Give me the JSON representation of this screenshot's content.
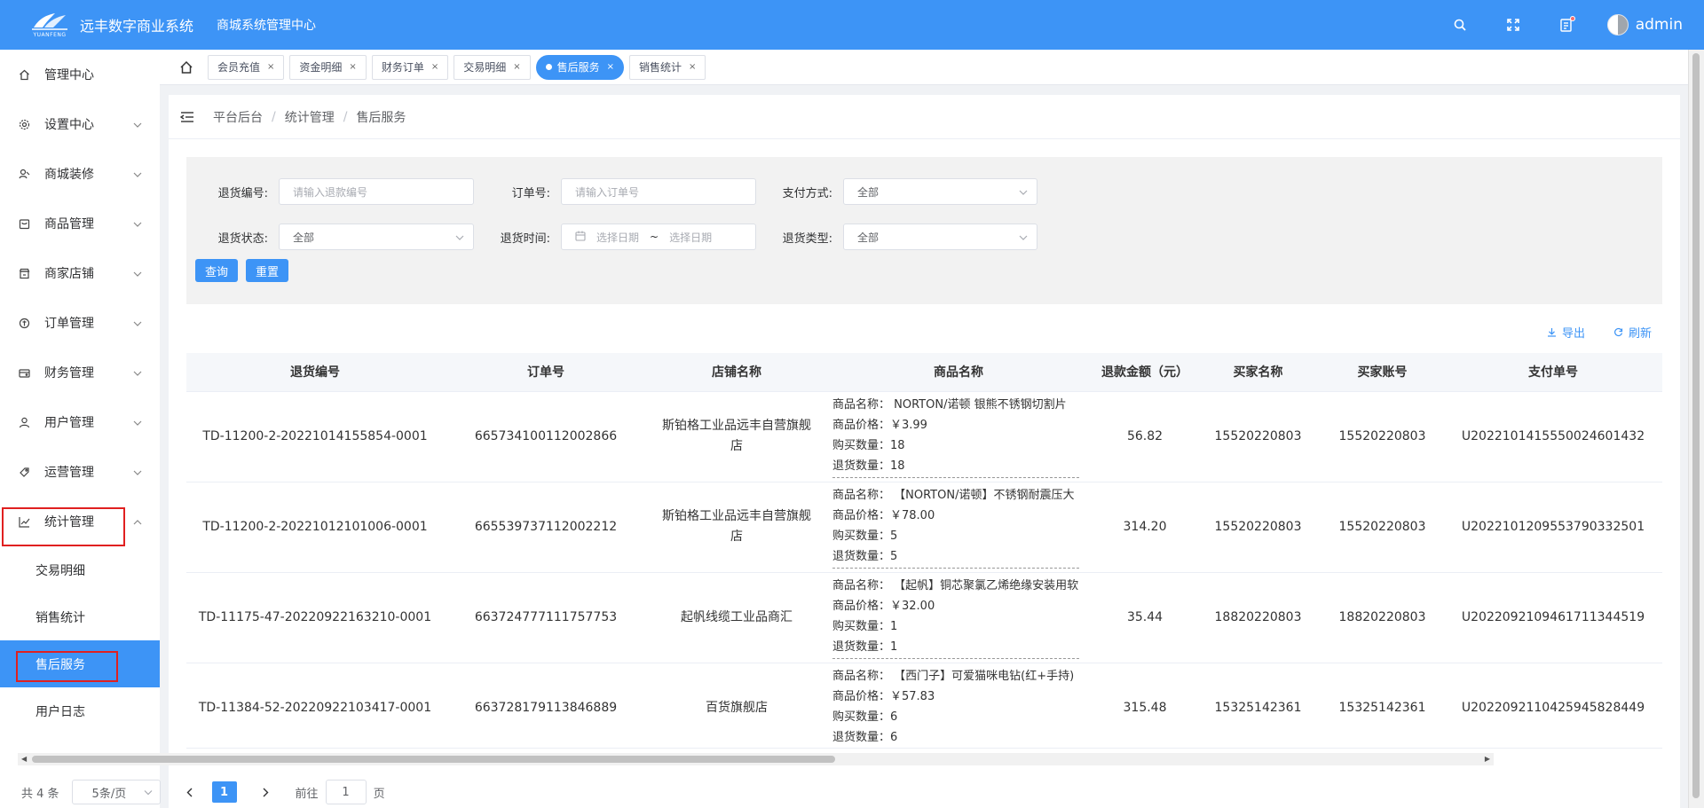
{
  "header": {
    "logo_text": "YUANFENG",
    "app_title": "远丰数字商业系统",
    "sub_title": "商城系统管理中心",
    "username": "admin"
  },
  "sidebar": {
    "items": [
      {
        "label": "管理中心",
        "icon": "home-icon"
      },
      {
        "label": "设置中心",
        "icon": "gear-icon"
      },
      {
        "label": "商城装修",
        "icon": "paint-icon"
      },
      {
        "label": "商品管理",
        "icon": "goods-icon"
      },
      {
        "label": "商家店铺",
        "icon": "store-icon"
      },
      {
        "label": "订单管理",
        "icon": "order-icon"
      },
      {
        "label": "财务管理",
        "icon": "finance-icon"
      },
      {
        "label": "用户管理",
        "icon": "user-icon"
      },
      {
        "label": "运营管理",
        "icon": "operation-icon"
      },
      {
        "label": "统计管理",
        "icon": "chart-icon"
      }
    ],
    "sub_items": [
      "交易明细",
      "销售统计",
      "售后服务",
      "用户日志"
    ],
    "active_sub": "售后服务"
  },
  "tabs": [
    {
      "label": "会员充值"
    },
    {
      "label": "资金明细"
    },
    {
      "label": "财务订单"
    },
    {
      "label": "交易明细"
    },
    {
      "label": "售后服务",
      "active": true
    },
    {
      "label": "销售统计"
    }
  ],
  "tab_close": "×",
  "breadcrumb": {
    "items": [
      "平台后台",
      "统计管理",
      "售后服务"
    ],
    "separator": "/"
  },
  "filter": {
    "return_no_label": "退货编号:",
    "return_no_placeholder": "请输入退款编号",
    "order_no_label": "订单号:",
    "order_no_placeholder": "请输入订单号",
    "pay_method_label": "支付方式:",
    "pay_method_value": "全部",
    "return_status_label": "退货状态:",
    "return_status_value": "全部",
    "return_time_label": "退货时间:",
    "date_start_placeholder": "选择日期",
    "date_sep": "~",
    "date_end_placeholder": "选择日期",
    "return_type_label": "退货类型:",
    "return_type_value": "全部",
    "query_button": "查询",
    "reset_button": "重置"
  },
  "tools": {
    "export_label": "导出",
    "refresh_label": "刷新"
  },
  "table": {
    "columns": [
      "退货编号",
      "订单号",
      "店铺名称",
      "商品名称",
      "退款金额（元）",
      "买家名称",
      "买家账号",
      "支付单号"
    ],
    "rows": [
      {
        "return_no": "TD-11200-2-20221014155854-0001",
        "order_no": "665734100112002866",
        "shop": "斯铂格工业品远丰自营旗舰店",
        "goods_name": "商品名称：  NORTON/诺顿 银熊不锈钢切割片",
        "goods_price": "商品价格：￥3.99",
        "buy_qty": "购买数量：18",
        "return_qty": "退货数量：18",
        "amount": "56.82",
        "buyer_name": "15520220803",
        "buyer_account": "15520220803",
        "pay_no": "U2022101415550024601432"
      },
      {
        "return_no": "TD-11200-2-20221012101006-0001",
        "order_no": "665539737112002212",
        "shop": "斯铂格工业品远丰自营旗舰店",
        "goods_name": "商品名称：  【NORTON/诺顿】不锈钢耐震压大",
        "goods_price": "商品价格：￥78.00",
        "buy_qty": "购买数量：5",
        "return_qty": "退货数量：5",
        "amount": "314.20",
        "buyer_name": "15520220803",
        "buyer_account": "15520220803",
        "pay_no": "U2022101209553790332501"
      },
      {
        "return_no": "TD-11175-47-20220922163210-0001",
        "order_no": "663724777111757753",
        "shop": "起帆线缆工业品商汇",
        "goods_name": "商品名称：  【起帆】铜芯聚氯乙烯绝缘安装用软",
        "goods_price": "商品价格：￥32.00",
        "buy_qty": "购买数量：1",
        "return_qty": "退货数量：1",
        "amount": "35.44",
        "buyer_name": "18820220803",
        "buyer_account": "18820220803",
        "pay_no": "U2022092109461711344519"
      },
      {
        "return_no": "TD-11384-52-20220922103417-0001",
        "order_no": "663728179113846889",
        "shop": "百货旗舰店",
        "goods_name": "商品名称：  【西门子】可爱猫咪电钻(红+手持)",
        "goods_price": "商品价格：￥57.83",
        "buy_qty": "购买数量：6",
        "return_qty": "退货数量：6",
        "amount": "315.48",
        "buyer_name": "15325142361",
        "buyer_account": "15325142361",
        "pay_no": "U2022092110425945828449"
      }
    ]
  },
  "pagination": {
    "total_text": "共 4 条",
    "page_size": "5条/页",
    "current_page": "1",
    "jump_label": "前往",
    "jump_value": "1",
    "page_unit": "页"
  },
  "colors": {
    "primary": "#3d94f6",
    "highlight_border": "#e02020"
  }
}
